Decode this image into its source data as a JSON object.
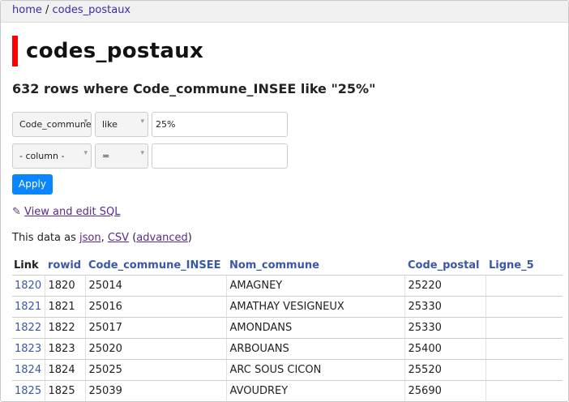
{
  "breadcrumb": {
    "home": "home",
    "sep": "/",
    "db": "codes_postaux"
  },
  "page": {
    "title": "codes_postaux",
    "subtitle": "632 rows where Code_commune_INSEE like \"25%\""
  },
  "filters": [
    {
      "column": "Code_commune_INSEE",
      "op": "like",
      "value": "25%"
    },
    {
      "column": "- column -",
      "op": "=",
      "value": ""
    }
  ],
  "apply_label": "Apply",
  "sql_link": {
    "icon": "✎",
    "label": "View and edit SQL"
  },
  "data_as": {
    "prefix": "This data as ",
    "json": "json",
    "comma": ", ",
    "csv": "CSV",
    "open": " (",
    "advanced": "advanced",
    "close": ")"
  },
  "table": {
    "headers": [
      "Link",
      "rowid",
      "Code_commune_INSEE",
      "Nom_commune",
      "Code_postal",
      "Ligne_5"
    ],
    "rows": [
      [
        "1820",
        "1820",
        "25014",
        "AMAGNEY",
        "25220",
        ""
      ],
      [
        "1821",
        "1821",
        "25016",
        "AMATHAY VESIGNEUX",
        "25330",
        ""
      ],
      [
        "1822",
        "1822",
        "25017",
        "AMONDANS",
        "25330",
        ""
      ],
      [
        "1823",
        "1823",
        "25020",
        "ARBOUANS",
        "25400",
        ""
      ],
      [
        "1824",
        "1824",
        "25025",
        "ARC SOUS CICON",
        "25520",
        ""
      ],
      [
        "1825",
        "1825",
        "25039",
        "AVOUDREY",
        "25690",
        ""
      ]
    ]
  },
  "colors": {
    "accent_red": "#ff0000",
    "button_blue": "#0a84ff",
    "link_blue": "#3a57a8"
  }
}
